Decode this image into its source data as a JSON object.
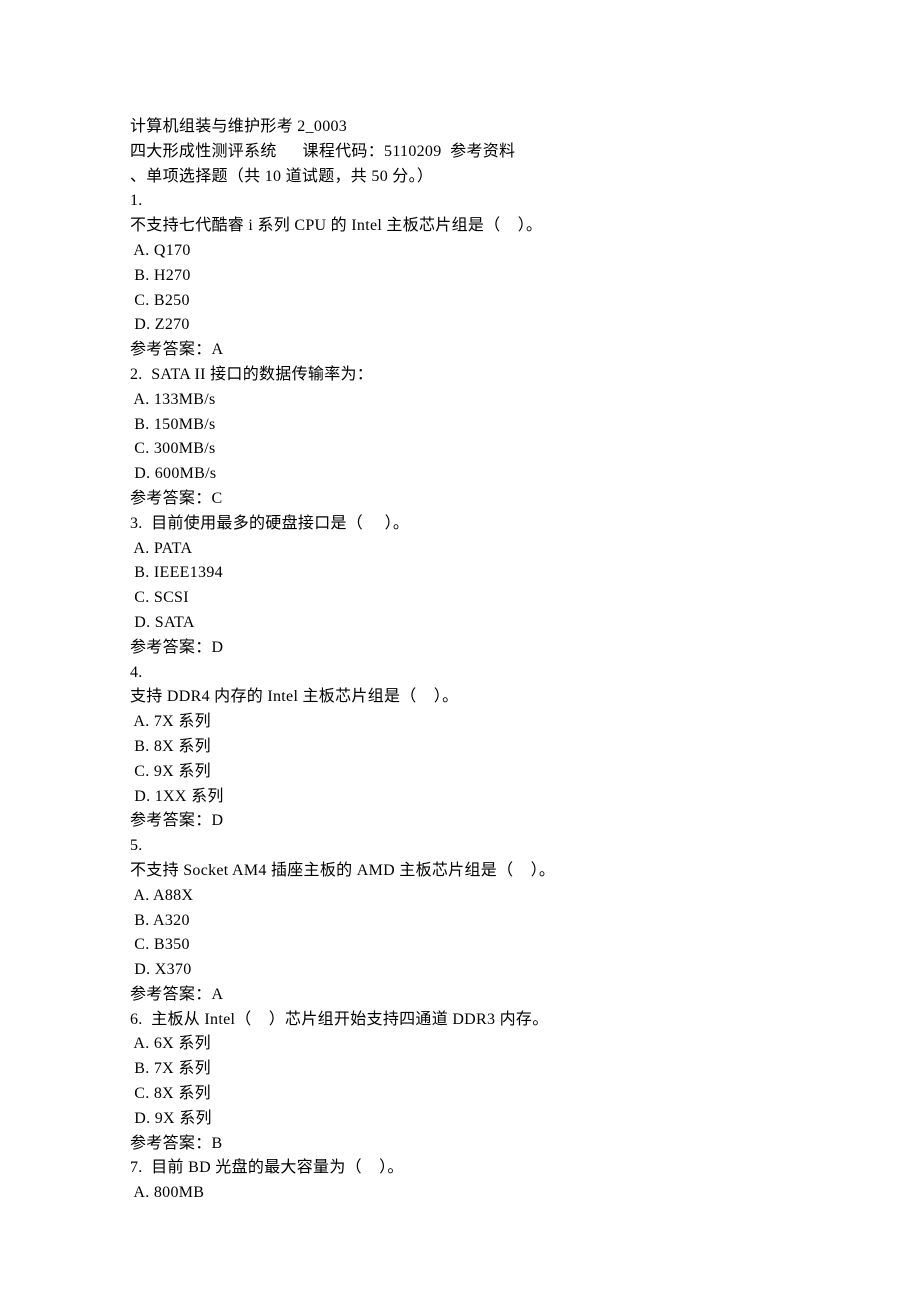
{
  "header": {
    "exam_title": "计算机组装与维护形考 2_0003",
    "system_name": "四大形成性测评系统",
    "course_code_label": "课程代码：",
    "course_code": "5110209",
    "ref_label": "参考资料",
    "section_title": "、单项选择题（共 10 道试题，共 50 分。）"
  },
  "questions": [
    {
      "num": "1.",
      "stem": "不支持七代酷睿 i 系列 CPU 的 Intel 主板芯片组是（    ）。",
      "options": [
        " A. Q170",
        " B. H270",
        " C. B250",
        " D. Z270"
      ],
      "answer": "参考答案：A"
    },
    {
      "num": "2.  SATA II 接口的数据传输率为：",
      "stem": "",
      "options": [
        " A. 133MB/s",
        " B. 150MB/s",
        " C. 300MB/s",
        " D. 600MB/s"
      ],
      "answer": "参考答案：C"
    },
    {
      "num": "3.  目前使用最多的硬盘接口是（     ）。",
      "stem": "",
      "options": [
        " A. PATA",
        " B. IEEE1394",
        " C. SCSI",
        " D. SATA"
      ],
      "answer": "参考答案：D"
    },
    {
      "num": "4.",
      "stem": "支持 DDR4 内存的 Intel 主板芯片组是（    ）。",
      "options": [
        " A. 7X 系列",
        " B. 8X 系列",
        " C. 9X 系列",
        " D. 1XX 系列"
      ],
      "answer": "参考答案：D"
    },
    {
      "num": "5.",
      "stem": "不支持 Socket AM4 插座主板的 AMD 主板芯片组是（    ）。",
      "options": [
        " A. A88X",
        " B. A320",
        " C. B350",
        " D. X370"
      ],
      "answer": "参考答案：A"
    },
    {
      "num": "6.  主板从 Intel（    ）芯片组开始支持四通道 DDR3 内存。",
      "stem": "",
      "options": [
        " A. 6X 系列",
        " B. 7X 系列",
        " C. 8X 系列",
        " D. 9X 系列"
      ],
      "answer": "参考答案：B"
    },
    {
      "num": "7.  目前 BD 光盘的最大容量为（    ）。",
      "stem": "",
      "options": [
        " A. 800MB"
      ],
      "answer": ""
    }
  ]
}
